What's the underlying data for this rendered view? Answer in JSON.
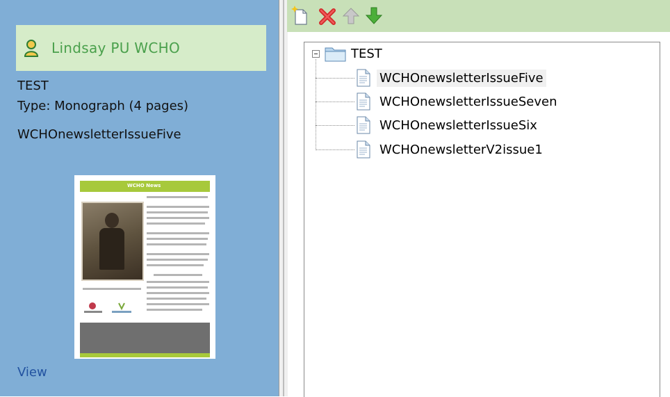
{
  "user": {
    "name": "Lindsay PU WCHO"
  },
  "document": {
    "title": "TEST",
    "type_line": "Type: Monograph (4 pages)",
    "current_file": "WCHOnewsletterIssueFive",
    "view_link": "View"
  },
  "thumbnail": {
    "banner_text": "WCHO News"
  },
  "toolbar": {
    "new_icon": "new-page-icon",
    "delete_icon": "delete-icon",
    "up_icon": "arrow-up-icon",
    "down_icon": "arrow-down-icon"
  },
  "tree": {
    "root": {
      "label": "TEST"
    },
    "children": [
      {
        "label": "WCHOnewsletterIssueFive",
        "selected": true
      },
      {
        "label": "WCHOnewsletterIssueSeven"
      },
      {
        "label": "WCHOnewsletterIssueSix"
      },
      {
        "label": "WCHOnewsletterV2issue1"
      }
    ]
  },
  "colors": {
    "left_panel_bg": "#80aed6",
    "user_box_bg": "#d6ecc9",
    "user_name": "#4aa04c",
    "toolbar_bg": "#c8e0b8",
    "link": "#2152a0"
  }
}
